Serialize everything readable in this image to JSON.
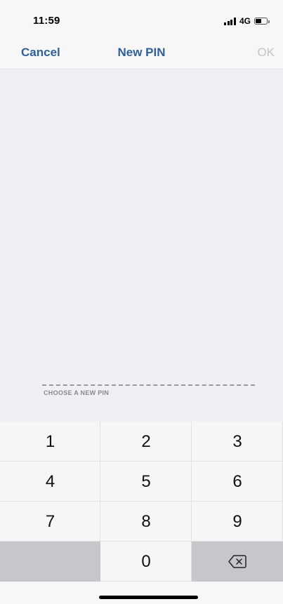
{
  "status_bar": {
    "time": "11:59",
    "network": "4G",
    "signal_bars": 4,
    "battery_level": 0.55
  },
  "nav": {
    "cancel_label": "Cancel",
    "title": "New PIN",
    "ok_label": "OK"
  },
  "pin": {
    "caption": "CHOOSE A NEW PIN"
  },
  "keypad": {
    "keys": [
      "1",
      "2",
      "3",
      "4",
      "5",
      "6",
      "7",
      "8",
      "9",
      "0"
    ],
    "delete_icon": "backspace-icon"
  },
  "colors": {
    "accent": "#2f5f99",
    "disabled": "#c4c4c6",
    "background": "#efeff4",
    "keypad_dark": "#c7c7cb"
  }
}
